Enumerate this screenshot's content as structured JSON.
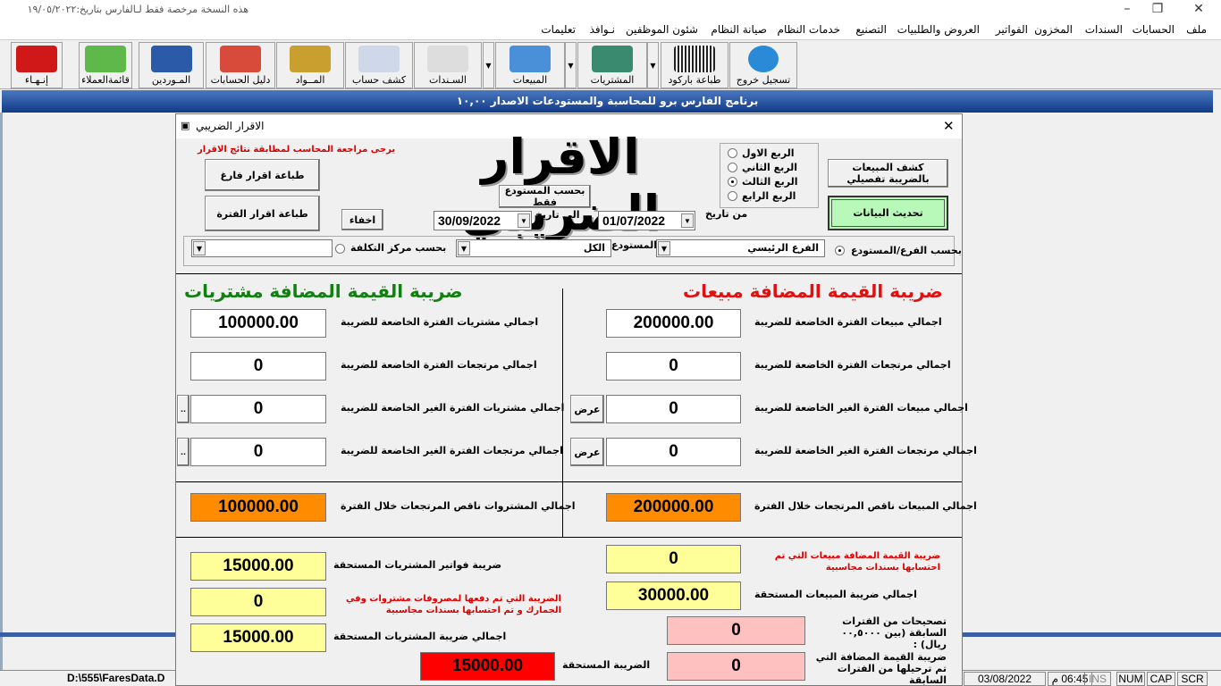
{
  "window": {
    "title": "هذه النسخة مرخصة فقط لـالفارس بتاريخ:١٩/٠٥/٢٠٢٢",
    "minimize": "–",
    "restore": "❐",
    "close": "✕"
  },
  "menu": [
    "ملف",
    "الحسابات",
    "السندات",
    "المخزون",
    "الفواتير",
    "العروض والطلبيات",
    "التصنيع",
    "خدمات النظام",
    "صيانة النظام",
    "شئون الموظفين",
    "نـوافذ",
    "تعليمات"
  ],
  "toolbar": [
    {
      "label": "إنـهـاء",
      "icon": "power-icon",
      "color": "#d01818"
    },
    {
      "label": "قائمةالعملاء",
      "icon": "add-user-icon",
      "color": "#5fb84a"
    },
    {
      "label": "المـوردين",
      "icon": "supplier-icon",
      "color": "#2a5aa8"
    },
    {
      "label": "دليل الحسابات",
      "icon": "accounts-guide-icon",
      "color": "#d84a3a"
    },
    {
      "label": "المــواد",
      "icon": "coins-icon",
      "color": "#c9a030"
    },
    {
      "label": "كشف حساب",
      "icon": "magnifier-icon",
      "color": "#cfd8e8"
    },
    {
      "label": "السـندات",
      "icon": "clipboard-icon",
      "color": "#dddddd"
    },
    {
      "label": "المبيعات",
      "icon": "tag-icon",
      "color": "#4a90d9"
    },
    {
      "label": "المشتريات",
      "icon": "books-icon",
      "color": "#3a8a70"
    },
    {
      "label": "طباعة باركود",
      "icon": "barcode-icon",
      "color": "#222222"
    },
    {
      "label": "تسجيل خروج",
      "icon": "logout-icon",
      "color": "#2a8ad8"
    }
  ],
  "banner": "برنامج الفارس برو للمحاسبة والمستودعات الاصدار ١٠,٠٠",
  "dialog": {
    "title": "الاقرار الضريبي",
    "close": "✕",
    "heading": "الاقرار الضريبي",
    "note": "يرجى مراجعة المحاسب لمطابقة نتائج الاقرار",
    "print_blank": "طباعة اقرار فارغ",
    "print_period": "طباعة اقرار الفترة",
    "hide": "اخفاء",
    "warehouse_only": "بحسب المستودع فقط",
    "to_label": "الى تاريخ",
    "to_date": "30/09/2022",
    "from_label": "من تاريخ",
    "from_date": "01/07/2022",
    "quarters": [
      {
        "label": "الربع الاول",
        "checked": false
      },
      {
        "label": "الربع الثاني",
        "checked": false
      },
      {
        "label": "الربع الثالث",
        "checked": true
      },
      {
        "label": "الربع الرابع",
        "checked": false
      }
    ],
    "sales_report": "كشف المبيعات بالضريبة تفصيلي",
    "refresh": "تحديث البيانات",
    "filter": {
      "by_branch": "بحسب الفرع/المستودع",
      "branch": "الفرع الرئيسي",
      "warehouse_label": "المستودع",
      "warehouse": "الكل",
      "by_cost_center": "بحسب مركز التكلفة",
      "cost_center": ""
    },
    "sales": {
      "heading": "ضريبة القيمة المضافة مبيعات",
      "rows": [
        {
          "label": "اجمالي مبيعات الفترة الخاضعة للضريبة",
          "value": "200000.00"
        },
        {
          "label": "اجمالي مرتجعات الفترة الخاضعة للضريبة",
          "value": "0"
        },
        {
          "label": "اجمالي مبيعات الفترة  الغير الخاضعة للضريبة",
          "value": "0",
          "button": "عرض"
        },
        {
          "label": "اجمالي مرتجعات الفترة الغير الخاضعة للضريبة",
          "value": "0",
          "button": "عرض"
        }
      ],
      "net_label": "اجمالي المبيعات ناقص المرتجعات  خلال الفترة",
      "net": "200000.00",
      "vouchers_label": "ضريبة القيمة المضافة مبيعات التي تم احتسابها بسندات مجاسبية",
      "vouchers": "0",
      "total_tax_label": "اجمالي ضريبة المبيعات المستحقة",
      "total_tax": "30000.00",
      "corrections_label": "تصحيحات من الفترات السابقة (بين ٠٠,٥٠٠٠ ريال) :",
      "corrections": "0",
      "carried_label": "ضريبة القيمة المضافة التي تم ترحيلها من الفترات السابقة",
      "carried": "0"
    },
    "purchases": {
      "heading": "ضريبة القيمة المضافة مشتريات",
      "rows": [
        {
          "label": "اجمالي مشتريات الفترة الخاضعة للضريبة",
          "value": "100000.00"
        },
        {
          "label": "اجمالي مرتجعات الفترة الخاضعة للضريبة",
          "value": "0"
        },
        {
          "label": "اجمالي مشتريات الفترة  الغير الخاضعة للضريبة",
          "value": "0",
          "button": ".."
        },
        {
          "label": "اجمالي مرتجعات الفترة الغير الخاضعة للضريبة",
          "value": "0",
          "button": ".."
        }
      ],
      "net_label": "اجمالي المشتروات ناقص المرتجعات خلال الفترة",
      "net": "100000.00",
      "invoices_tax_label": "ضريبة فواتير المشتريات المستحقة",
      "invoices_tax": "15000.00",
      "expenses_label": "الضريبة التي تم دفعها لمصروفات مشتروات وفي الجمارك و تم احتسابها بسندات مجاسبية",
      "expenses": "0",
      "total_tax_label": "اجمالي ضريبة المشتريات المستحقة",
      "total_tax": "15000.00"
    },
    "due_label": "الضريبة المستحقة",
    "due": "15000.00"
  },
  "status": {
    "path": "D:\\555\\FaresData.D",
    "date": "03/08/2022",
    "time": "06:45 م",
    "ins": "INS",
    "num": "NUM",
    "cap": "CAP",
    "scr": "SCR"
  }
}
